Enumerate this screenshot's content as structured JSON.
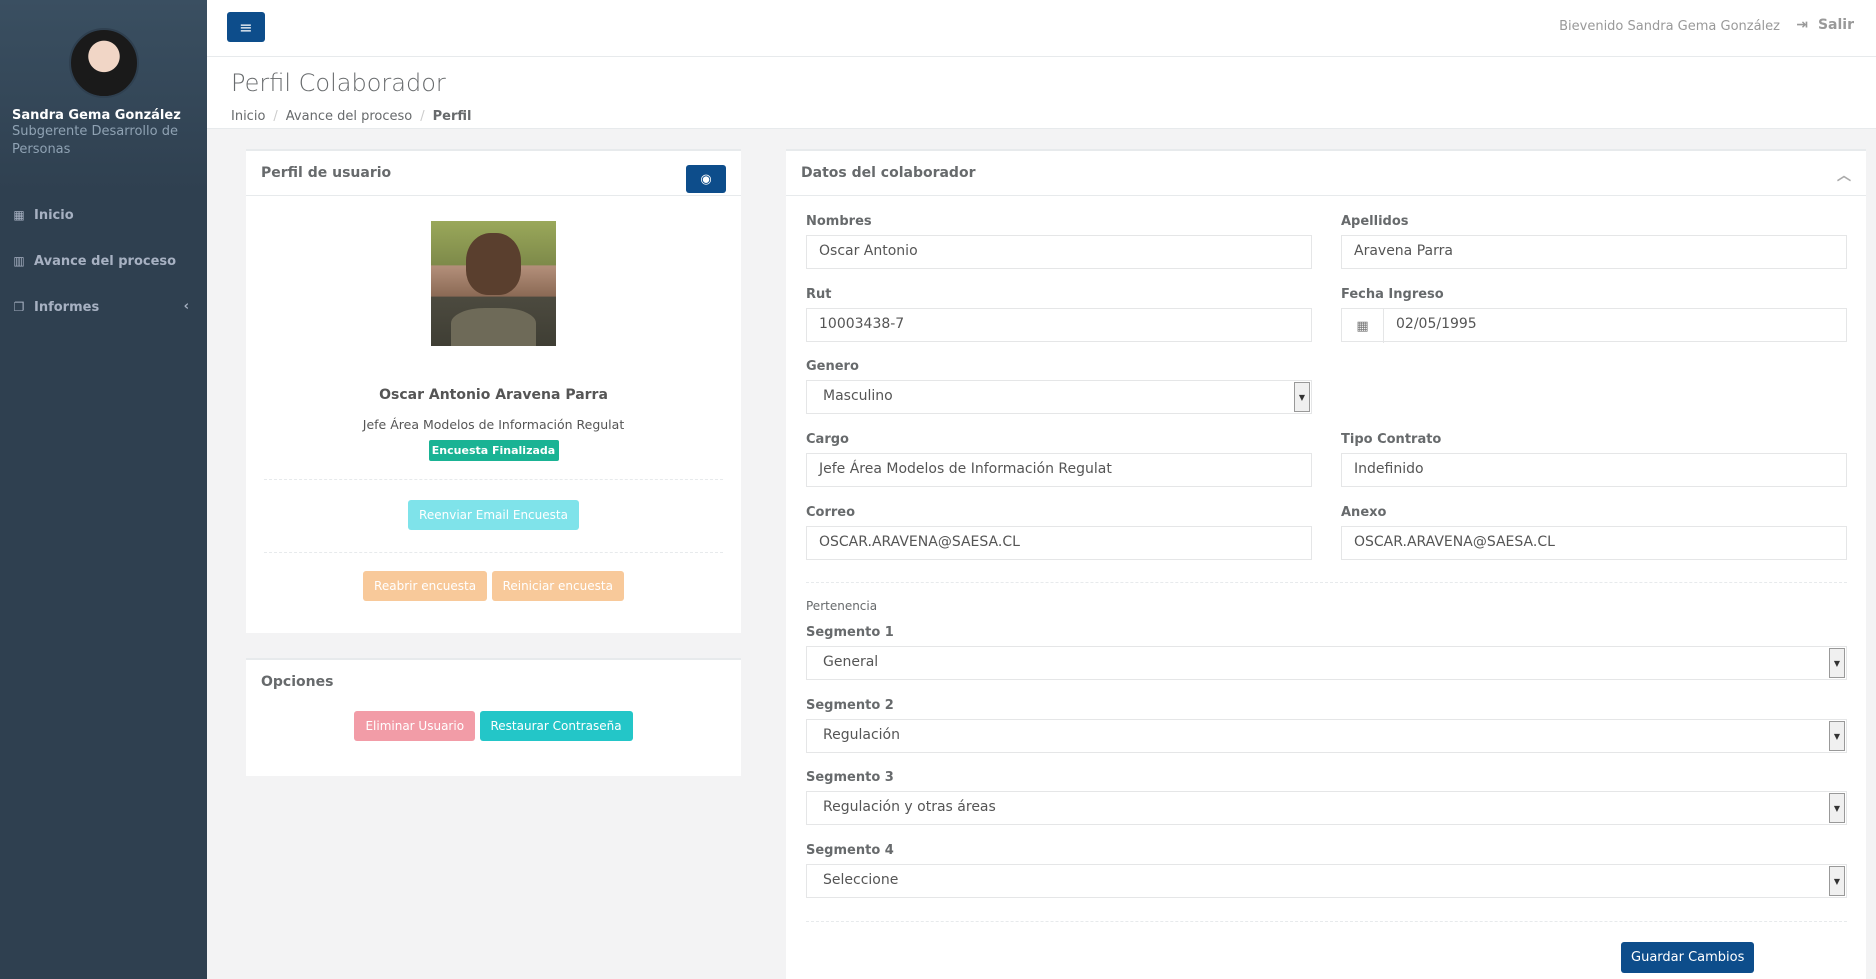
{
  "sidebar": {
    "user_name": "Sandra Gema González",
    "user_role": "Subgerente Desarrollo de Personas",
    "items": [
      {
        "label": "Inicio",
        "icon": "th-large-icon"
      },
      {
        "label": "Avance del proceso",
        "icon": "bar-chart-icon"
      },
      {
        "label": "Informes",
        "icon": "copy-icon"
      }
    ]
  },
  "topbar": {
    "welcome": "Bievenido Sandra Gema González",
    "logout": "Salir"
  },
  "heading": {
    "title": "Perfil Colaborador",
    "breadcrumb": [
      "Inicio",
      "Avance del proceso",
      "Perfil"
    ]
  },
  "profile_panel": {
    "title": "Perfil de usuario",
    "name": "Oscar Antonio Aravena Parra",
    "job": "Jefe Área Modelos de Información Regulat",
    "badge": "Encuesta Finalizada",
    "resend_button": "Reenviar Email Encuesta",
    "reopen_button": "Reabrir encuesta",
    "restart_button": "Reiniciar encuesta"
  },
  "options_panel": {
    "title": "Opciones",
    "delete_button": "Eliminar Usuario",
    "reset_button": "Restaurar Contraseña"
  },
  "data_panel": {
    "title": "Datos del colaborador",
    "fields": {
      "nombres": {
        "label": "Nombres",
        "value": "Oscar Antonio"
      },
      "apellidos": {
        "label": "Apellidos",
        "value": "Aravena Parra"
      },
      "rut": {
        "label": "Rut",
        "value": "10003438-7"
      },
      "fecha": {
        "label": "Fecha Ingreso",
        "value": "02/05/1995"
      },
      "genero": {
        "label": "Genero",
        "value": "Masculino"
      },
      "cargo": {
        "label": "Cargo",
        "value": "Jefe Área Modelos de Información Regulat"
      },
      "tipo": {
        "label": "Tipo Contrato",
        "value": "Indefinido"
      },
      "correo": {
        "label": "Correo",
        "value": "OSCAR.ARAVENA@SAESA.CL"
      },
      "anexo": {
        "label": "Anexo",
        "value": "OSCAR.ARAVENA@SAESA.CL"
      }
    },
    "pertenencia": "Pertenencia",
    "segments": [
      {
        "label": "Segmento 1",
        "value": "General"
      },
      {
        "label": "Segmento 2",
        "value": "Regulación"
      },
      {
        "label": "Segmento 3",
        "value": "Regulación y otras áreas"
      },
      {
        "label": "Segmento 4",
        "value": "Seleccione"
      }
    ],
    "save_button": "Guardar Cambios"
  }
}
